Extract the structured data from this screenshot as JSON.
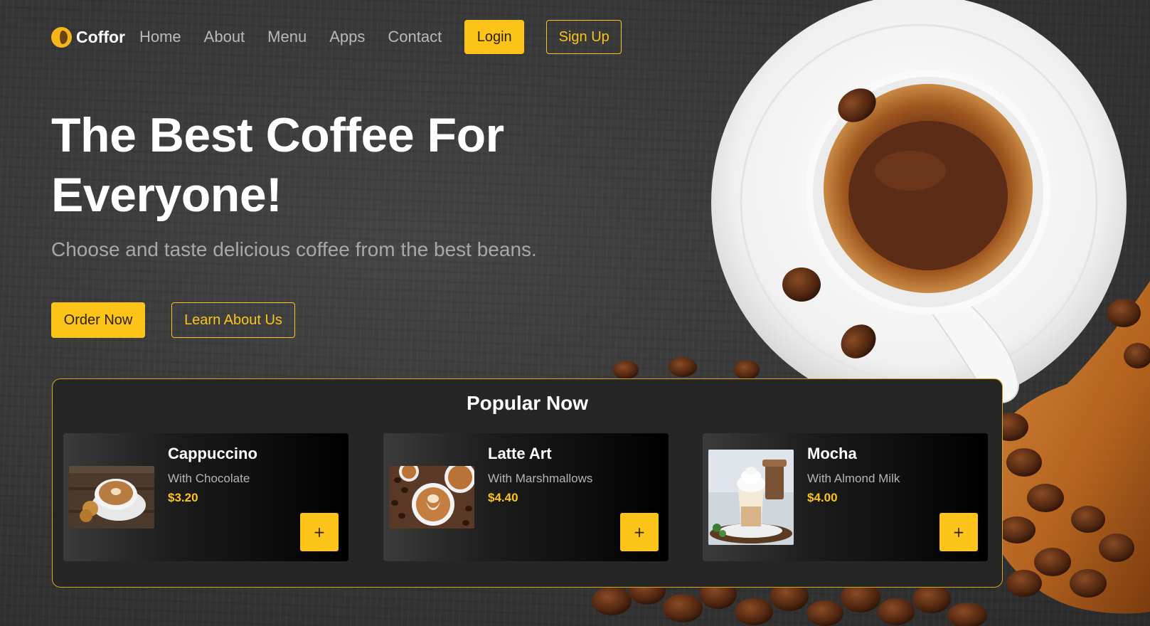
{
  "brand": {
    "name": "Coffor",
    "icon": "coffee-bean-icon",
    "accent_color": "#fcc419"
  },
  "nav": {
    "links": [
      {
        "label": "Home"
      },
      {
        "label": "About"
      },
      {
        "label": "Menu"
      },
      {
        "label": "Apps"
      },
      {
        "label": "Contact"
      }
    ],
    "login_label": "Login",
    "signup_label": "Sign Up"
  },
  "hero": {
    "title_line1": "The Best Coffee For",
    "title_line2": "Everyone!",
    "subtitle": "Choose and taste delicious coffee from the best beans.",
    "order_label": "Order Now",
    "learn_label": "Learn About Us"
  },
  "popular": {
    "title": "Popular Now",
    "items": [
      {
        "name": "Cappuccino",
        "description": "With Chocolate",
        "price": "$3.20",
        "add_label": "+"
      },
      {
        "name": "Latte Art",
        "description": "With Marshmallows",
        "price": "$4.40",
        "add_label": "+"
      },
      {
        "name": "Mocha",
        "description": "With Almond Milk",
        "price": "$4.00",
        "add_label": "+"
      }
    ]
  }
}
